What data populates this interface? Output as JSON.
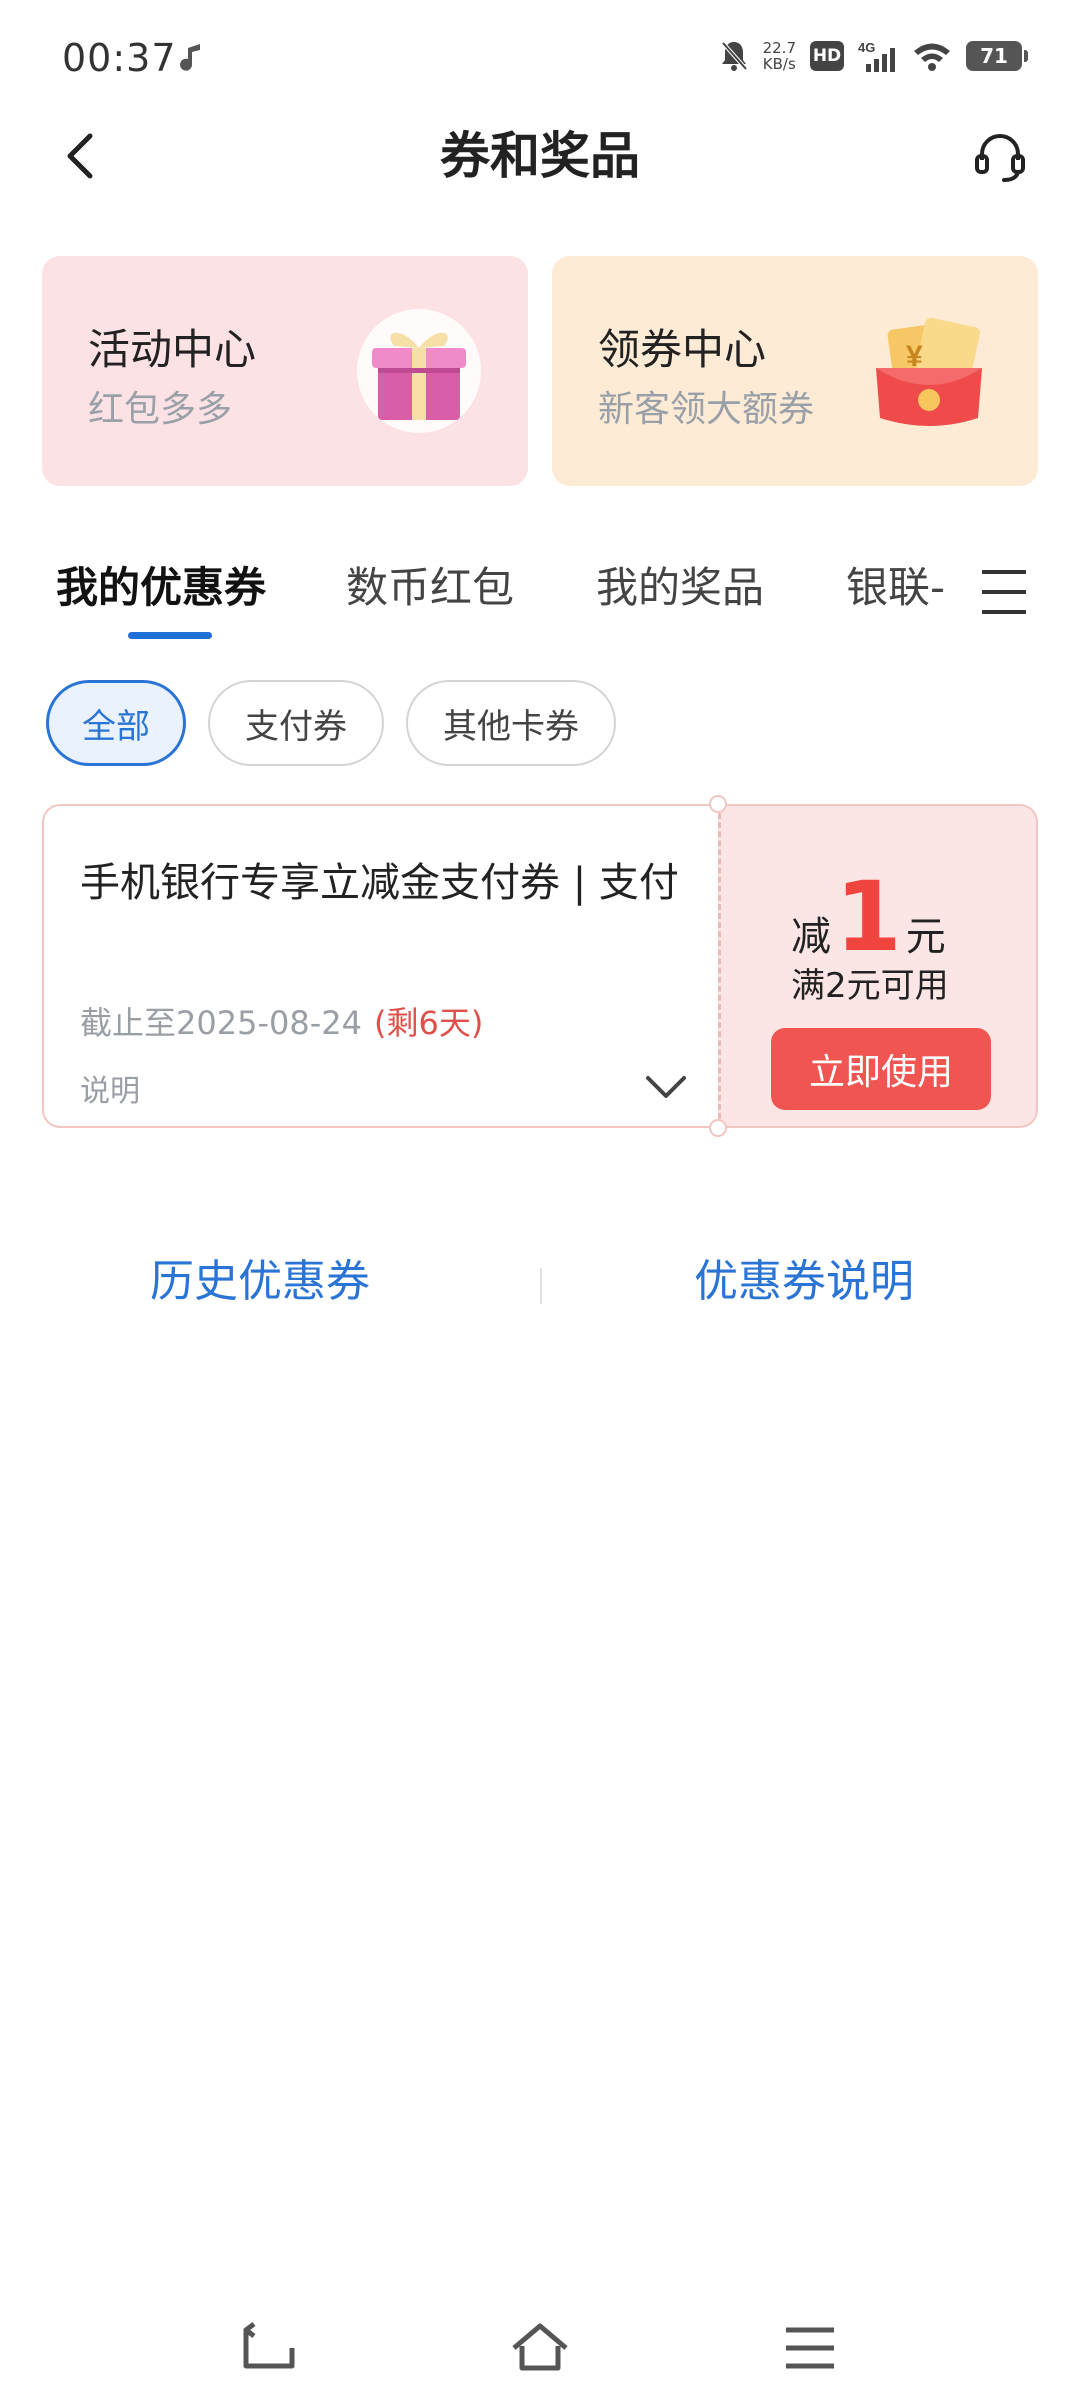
{
  "status_bar": {
    "time": "00:37",
    "net_speed": "22.7",
    "net_speed_unit": "KB/s",
    "hd": "HD",
    "network": "4G",
    "battery": "71"
  },
  "header": {
    "title": "券和奖品"
  },
  "promos": [
    {
      "title": "活动中心",
      "subtitle": "红包多多",
      "icon": "gift-box-icon"
    },
    {
      "title": "领券中心",
      "subtitle": "新客领大额券",
      "icon": "red-envelope-icon"
    }
  ],
  "tabs": [
    {
      "label": "我的优惠券",
      "active": true
    },
    {
      "label": "数币红包",
      "active": false
    },
    {
      "label": "我的奖品",
      "active": false
    },
    {
      "label": "银联-",
      "active": false
    }
  ],
  "filters": [
    {
      "label": "全部",
      "active": true
    },
    {
      "label": "支付券",
      "active": false
    },
    {
      "label": "其他卡券",
      "active": false
    }
  ],
  "coupon": {
    "name": "手机银行专享立减金支付券 | 支付",
    "expiry": "截止至2025-08-24",
    "remaining": "(剩6天)",
    "desc_label": "说明",
    "reduce_prefix": "减",
    "amount": "1",
    "unit": "元",
    "condition": "满2元可用",
    "use_label": "立即使用"
  },
  "footer": {
    "history_label": "历史优惠券",
    "rules_label": "优惠券说明"
  },
  "colors": {
    "accent": "#2a74d6",
    "highlight": "#f0453f",
    "activity_bg": "#fde2e5",
    "coupon_center_bg": "#fdebd6"
  }
}
